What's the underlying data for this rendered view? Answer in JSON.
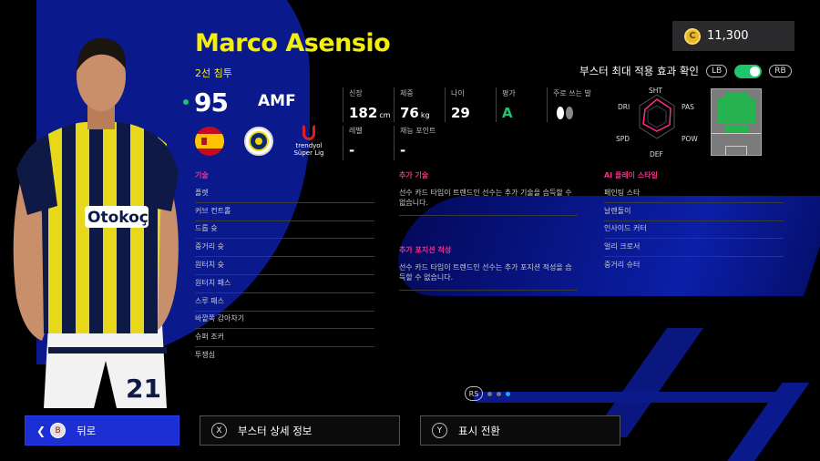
{
  "player": {
    "name": "Marco Asensio",
    "subtitle": "2선 침투",
    "rating": "95",
    "position": "AMF",
    "league_logo_text": "trendyol Süper Lig"
  },
  "wallet": {
    "coins": "11,300"
  },
  "booster": {
    "label": "부스터 최대 적용 효과 확인",
    "lb": "LB",
    "rb": "RB",
    "enabled": true
  },
  "stats": {
    "height_label": "신장",
    "height_value": "182",
    "height_unit": "cm",
    "weight_label": "체중",
    "weight_value": "76",
    "weight_unit": "kg",
    "age_label": "나이",
    "age_value": "29",
    "eval_label": "평가",
    "eval_value": "A",
    "foot_label": "주로 쓰는 발",
    "level_label": "레벨",
    "level_value": "-",
    "talent_label": "재능 포인트",
    "talent_value": "-"
  },
  "radar": {
    "shot": "SHT",
    "pass": "PAS",
    "power": "POW",
    "defence": "DEF",
    "speed": "SPD",
    "dribble": "DRI"
  },
  "skills": {
    "heading": "기술",
    "items": [
      "플렛",
      "커브 컨트롤",
      "드롭 슛",
      "중거리 슛",
      "원터치 슛",
      "원터치 패스",
      "스루 패스",
      "바깥쪽 감아차기",
      "슈퍼 조커",
      "투쟁심"
    ]
  },
  "extra_skills": {
    "heading": "추가 기술",
    "text": "선수 카드 타입이 트렌드인 선수는 추가 기술을 습득할 수 없습니다."
  },
  "extra_positions": {
    "heading": "추가 포지션 적성",
    "text": "선수 카드 타입이 트렌드인 선수는 추가 포지션 적성을 습득할 수 없습니다."
  },
  "ai_styles": {
    "heading": "AI 플레이 스타일",
    "items": [
      "페인팅 스타",
      "날렌돌이",
      "인사이드 커터",
      "얼리 크로서",
      "중거리 슈터"
    ]
  },
  "pager": {
    "rs": "RS",
    "pages": 3,
    "current": 3
  },
  "footer": {
    "back_key": "B",
    "back_label": "뒤로",
    "detail_key": "X",
    "detail_label": "부스터 상세 정보",
    "toggle_key": "Y",
    "toggle_label": "표시 전환"
  },
  "colors": {
    "accent_yellow": "#f3ee0a",
    "accent_pink": "#ff2a8a",
    "primary_blue": "#1c2fd4",
    "green": "#1fc56a"
  }
}
